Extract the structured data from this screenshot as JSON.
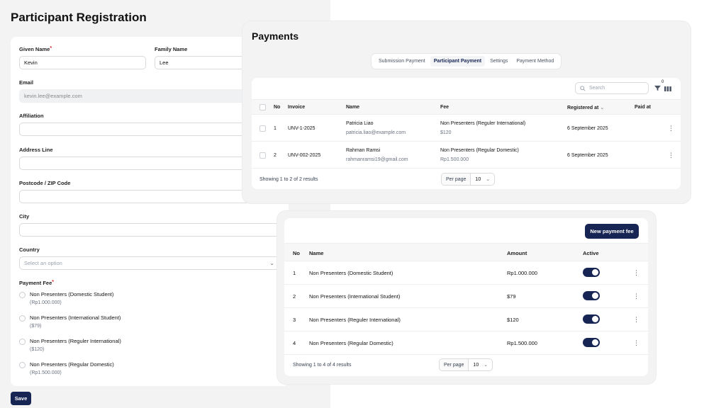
{
  "registration": {
    "title": "Participant Registration",
    "given_name": {
      "label": "Given Name",
      "value": "Kevin"
    },
    "family_name": {
      "label": "Family Name",
      "value": "Lee"
    },
    "email": {
      "label": "Email",
      "value": "kevin.lee@example.com"
    },
    "affiliation": {
      "label": "Affiliation",
      "value": ""
    },
    "address": {
      "label": "Address Line",
      "value": ""
    },
    "postcode": {
      "label": "Postcode / ZIP Code",
      "value": ""
    },
    "city": {
      "label": "City",
      "value": ""
    },
    "country": {
      "label": "Country",
      "placeholder": "Select an option"
    },
    "payment_fee": {
      "label": "Payment Fee",
      "options": [
        {
          "name": "Non Presenters (Domestic Student)",
          "price": "(Rp1.000.000)"
        },
        {
          "name": "Non Presenters (International Student)",
          "price": "($79)"
        },
        {
          "name": "Non Presenters (Reguler International)",
          "price": "($120)"
        },
        {
          "name": "Non Presenters (Regular Domestic)",
          "price": "(Rp1.500.000)"
        }
      ]
    },
    "save_label": "Save"
  },
  "payments": {
    "title": "Payments",
    "tabs": [
      {
        "label": "Submission Payment",
        "active": false
      },
      {
        "label": "Participant Payment",
        "active": true
      },
      {
        "label": "Settings",
        "active": false
      },
      {
        "label": "Payment Method",
        "active": false
      }
    ],
    "search_placeholder": "Search",
    "filter_count": "0",
    "columns": [
      "No",
      "Invoice",
      "Name",
      "Fee",
      "Registered at",
      "Paid at"
    ],
    "rows": [
      {
        "no": "1",
        "invoice": "UNV-1-2025",
        "name": "Patricia Liao",
        "email": "patricia.liao@example.com",
        "fee": "Non Presenters (Reguler International)",
        "amount": "$120",
        "registered": "6 September 2025",
        "paid": ""
      },
      {
        "no": "2",
        "invoice": "UNV-002-2025",
        "name": "Rahman Ramsi",
        "email": "rahmanramsi19@gmail.com",
        "fee": "Non Presenters (Regular Domestic)",
        "amount": "Rp1.500.000",
        "registered": "6 September 2025",
        "paid": ""
      }
    ],
    "summary": "Showing 1 to 2 of 2 results",
    "per_page_label": "Per page",
    "per_page_value": "10"
  },
  "fees": {
    "new_button": "New payment fee",
    "columns": [
      "No",
      "Name",
      "Amount",
      "Active"
    ],
    "rows": [
      {
        "no": "1",
        "name": "Non Presenters (Domestic Student)",
        "amount": "Rp1.000.000",
        "active": true
      },
      {
        "no": "2",
        "name": "Non Presenters (International Student)",
        "amount": "$79",
        "active": true
      },
      {
        "no": "3",
        "name": "Non Presenters (Reguler International)",
        "amount": "$120",
        "active": true
      },
      {
        "no": "4",
        "name": "Non Presenters (Regular Domestic)",
        "amount": "Rp1.500.000",
        "active": true
      }
    ],
    "summary": "Showing 1 to 4 of 4 results",
    "per_page_label": "Per page",
    "per_page_value": "10"
  },
  "colors": {
    "primary": "#172554",
    "required": "#dc2626",
    "panel_bg": "#f3f3f4"
  }
}
